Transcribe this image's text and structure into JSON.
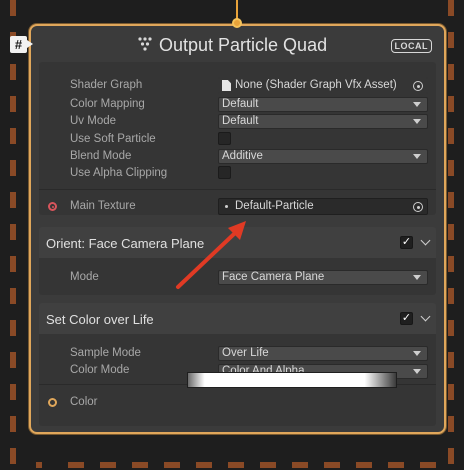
{
  "sticky": {
    "glyph": "#"
  },
  "node": {
    "title": "Output Particle Quad",
    "badge": "LOCAL",
    "icon": "particle-dots-icon",
    "accent_color": "#e0a75b",
    "flow_color": "#e8a33a"
  },
  "main": {
    "shader_graph": {
      "label": "Shader Graph",
      "value": "None (Shader Graph Vfx Asset)",
      "icon": "file-icon"
    },
    "color_mapping": {
      "label": "Color Mapping",
      "value": "Default"
    },
    "uv_mode": {
      "label": "Uv Mode",
      "value": "Default"
    },
    "use_soft_particle": {
      "label": "Use Soft Particle",
      "checked": false
    },
    "blend_mode": {
      "label": "Blend Mode",
      "value": "Additive"
    },
    "use_alpha_clipping": {
      "label": "Use Alpha Clipping",
      "checked": false
    },
    "main_texture": {
      "label": "Main Texture",
      "value": "Default-Particle",
      "port_color": "#d9555c"
    }
  },
  "orient_block": {
    "title": "Orient: Face Camera Plane",
    "enabled": true,
    "mode": {
      "label": "Mode",
      "value": "Face Camera Plane"
    }
  },
  "color_block": {
    "title": "Set Color over Life",
    "enabled": true,
    "sample_mode": {
      "label": "Sample Mode",
      "value": "Over Life"
    },
    "color_mode": {
      "label": "Color Mode",
      "value": "Color And Alpha"
    },
    "color": {
      "label": "Color",
      "port_color": "#e0a75b"
    }
  },
  "annotation": {
    "arrow_color": "#e03a24"
  }
}
